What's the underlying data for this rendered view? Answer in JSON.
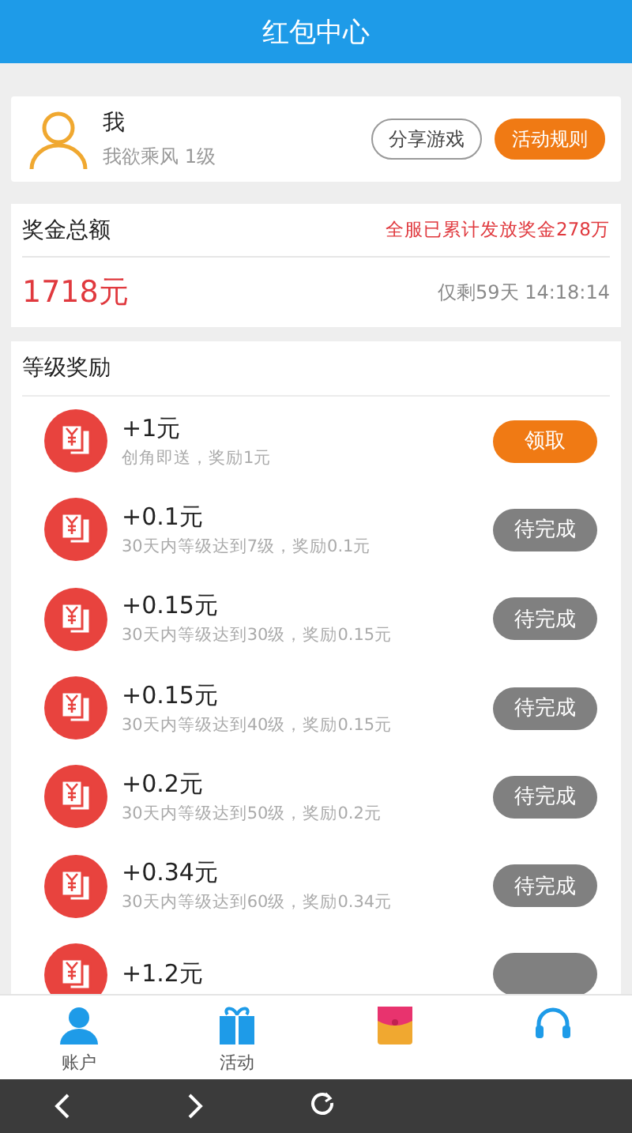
{
  "header": {
    "title": "红包中心"
  },
  "profile": {
    "name": "我",
    "subtitle": "我欲乘风 1级",
    "buttons": [
      {
        "label": "分享游戏",
        "kind": "outline"
      },
      {
        "label": "活动规则",
        "kind": "filled"
      }
    ]
  },
  "bonus": {
    "title": "奖金总额",
    "note": "全服已累计发放奖金278万",
    "amount": "1718元",
    "countdown": "仅剩59天 14:18:14"
  },
  "rewards": {
    "title": "等级奖励",
    "items": [
      {
        "amount": "+1元",
        "description": "创角即送，奖励1元",
        "action": "领取",
        "claimable": true
      },
      {
        "amount": "+0.1元",
        "description": "30天内等级达到7级，奖励0.1元",
        "action": "待完成",
        "claimable": false
      },
      {
        "amount": "+0.15元",
        "description": "30天内等级达到30级，奖励0.15元",
        "action": "待完成",
        "claimable": false
      },
      {
        "amount": "+0.15元",
        "description": "30天内等级达到40级，奖励0.15元",
        "action": "待完成",
        "claimable": false
      },
      {
        "amount": "+0.2元",
        "description": "30天内等级达到50级，奖励0.2元",
        "action": "待完成",
        "claimable": false
      },
      {
        "amount": "+0.34元",
        "description": "30天内等级达到60级，奖励0.34元",
        "action": "待完成",
        "claimable": false
      },
      {
        "amount": "+1.2元",
        "claimable": false
      }
    ]
  },
  "tabbar": [
    {
      "kind": "account",
      "label": "账户"
    },
    {
      "kind": "gift",
      "label": "活动"
    },
    {
      "kind": "envelope"
    },
    {
      "kind": "support"
    }
  ],
  "browser_nav": [
    {
      "kind": "back"
    },
    {
      "kind": "forward"
    },
    {
      "kind": "refresh"
    }
  ]
}
